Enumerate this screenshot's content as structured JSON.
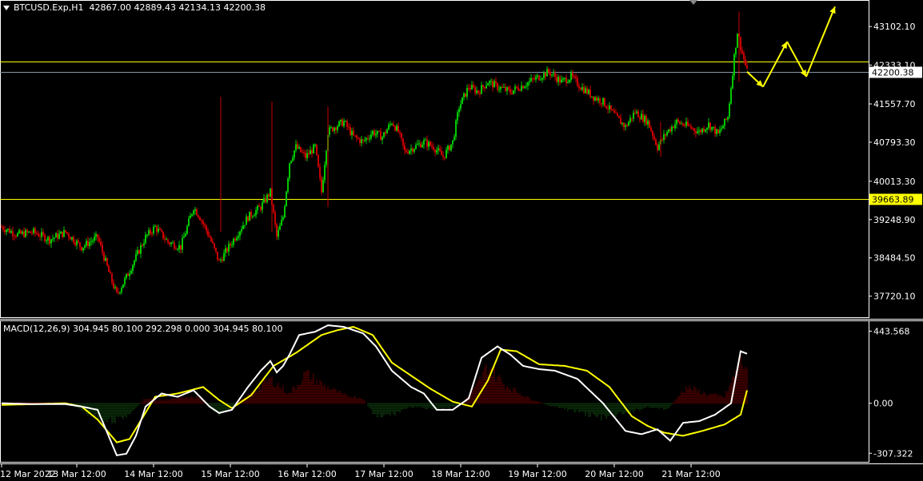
{
  "header": {
    "symbol_line": "BTCUSD.Exp,H1",
    "ohlc": "42867.00 42889.43 42134.13 42200.38"
  },
  "macd_header": "MACD(12,26,9) 304.945 80.100 292.298 0.000 304.945 80.100",
  "colors": {
    "background": "#000000",
    "bull": "#00c800",
    "bear": "#c80000",
    "level": "#ffff00",
    "bid_line": "#8899aa",
    "arrow": "#ffff00",
    "macd_line": "#ffffff",
    "signal_line": "#ffff00"
  },
  "chart_data": [
    {
      "type": "candlestick",
      "title": "BTCUSD.Exp,H1",
      "ylim": [
        37300,
        43600
      ],
      "y_ticks": [
        "43102.10",
        "42333.10",
        "41557.70",
        "40793.30",
        "40013.30",
        "39248.90",
        "38484.50",
        "37720.10"
      ],
      "x_ticks": [
        "12 Mar 2022",
        "13 Mar 12:00",
        "14 Mar 12:00",
        "15 Mar 12:00",
        "16 Mar 12:00",
        "17 Mar 12:00",
        "18 Mar 12:00",
        "19 Mar 12:00",
        "20 Mar 12:00",
        "21 Mar 12:00"
      ],
      "levels": [
        {
          "value": 42400,
          "label": ""
        },
        {
          "value": 39663.89,
          "label": "39663.89"
        }
      ],
      "bid": {
        "value": 42200.38,
        "label": "42200.38"
      },
      "close_path": [
        [
          0,
          39100
        ],
        [
          10,
          38950
        ],
        [
          20,
          39000
        ],
        [
          30,
          38850
        ],
        [
          40,
          39000
        ],
        [
          50,
          38700
        ],
        [
          60,
          38900
        ],
        [
          68,
          38100
        ],
        [
          72,
          37750
        ],
        [
          78,
          38100
        ],
        [
          84,
          38500
        ],
        [
          90,
          38900
        ],
        [
          96,
          39100
        ],
        [
          104,
          38800
        ],
        [
          112,
          38700
        ],
        [
          120,
          39500
        ],
        [
          124,
          39300
        ],
        [
          130,
          38900
        ],
        [
          136,
          38400
        ],
        [
          144,
          38800
        ],
        [
          154,
          39300
        ],
        [
          162,
          39500
        ],
        [
          168,
          39800
        ],
        [
          172,
          38900
        ],
        [
          176,
          39300
        ],
        [
          180,
          40400
        ],
        [
          184,
          40700
        ],
        [
          190,
          40500
        ],
        [
          196,
          40700
        ],
        [
          200,
          39800
        ],
        [
          204,
          41000
        ],
        [
          208,
          41100
        ],
        [
          214,
          41200
        ],
        [
          220,
          40900
        ],
        [
          226,
          40800
        ],
        [
          232,
          41000
        ],
        [
          238,
          40900
        ],
        [
          244,
          41200
        ],
        [
          248,
          41000
        ],
        [
          252,
          40600
        ],
        [
          258,
          40700
        ],
        [
          264,
          40800
        ],
        [
          270,
          40700
        ],
        [
          276,
          40500
        ],
        [
          282,
          40800
        ],
        [
          286,
          41500
        ],
        [
          292,
          41900
        ],
        [
          298,
          41800
        ],
        [
          304,
          42000
        ],
        [
          310,
          41900
        ],
        [
          318,
          41800
        ],
        [
          324,
          41900
        ],
        [
          330,
          42000
        ],
        [
          336,
          42100
        ],
        [
          342,
          42200
        ],
        [
          350,
          42000
        ],
        [
          356,
          42100
        ],
        [
          362,
          41900
        ],
        [
          370,
          41700
        ],
        [
          376,
          41600
        ],
        [
          384,
          41300
        ],
        [
          390,
          41100
        ],
        [
          396,
          41400
        ],
        [
          404,
          41200
        ],
        [
          410,
          40700
        ],
        [
          416,
          41000
        ],
        [
          422,
          41200
        ],
        [
          430,
          41100
        ],
        [
          436,
          41000
        ],
        [
          442,
          41150
        ],
        [
          448,
          40950
        ],
        [
          454,
          41300
        ],
        [
          458,
          42500
        ],
        [
          460,
          43000
        ],
        [
          462,
          42700
        ],
        [
          466,
          42200
        ]
      ],
      "forecast_path": [
        [
          466,
          42200
        ],
        [
          476,
          41900
        ],
        [
          491,
          42800
        ],
        [
          503,
          42100
        ],
        [
          521,
          43500
        ]
      ]
    },
    {
      "type": "macd",
      "title": "MACD(12,26,9)",
      "ylim": [
        -360,
        500
      ],
      "y_ticks": [
        "443.568",
        "0.00",
        "-307.322"
      ],
      "macd_path": [
        [
          0,
          0
        ],
        [
          20,
          -5
        ],
        [
          40,
          -5
        ],
        [
          50,
          -20
        ],
        [
          60,
          -40
        ],
        [
          66,
          -180
        ],
        [
          72,
          -320
        ],
        [
          78,
          -310
        ],
        [
          84,
          -200
        ],
        [
          90,
          -20
        ],
        [
          100,
          60
        ],
        [
          110,
          40
        ],
        [
          120,
          80
        ],
        [
          124,
          40
        ],
        [
          130,
          -20
        ],
        [
          136,
          -60
        ],
        [
          144,
          -40
        ],
        [
          154,
          100
        ],
        [
          162,
          200
        ],
        [
          168,
          260
        ],
        [
          172,
          190
        ],
        [
          176,
          230
        ],
        [
          180,
          300
        ],
        [
          186,
          420
        ],
        [
          196,
          440
        ],
        [
          204,
          480
        ],
        [
          214,
          470
        ],
        [
          226,
          430
        ],
        [
          234,
          350
        ],
        [
          244,
          200
        ],
        [
          256,
          100
        ],
        [
          264,
          60
        ],
        [
          272,
          -40
        ],
        [
          282,
          -40
        ],
        [
          292,
          30
        ],
        [
          300,
          280
        ],
        [
          310,
          350
        ],
        [
          318,
          300
        ],
        [
          326,
          230
        ],
        [
          336,
          210
        ],
        [
          346,
          200
        ],
        [
          360,
          150
        ],
        [
          376,
          0
        ],
        [
          390,
          -170
        ],
        [
          400,
          -190
        ],
        [
          410,
          -160
        ],
        [
          418,
          -230
        ],
        [
          426,
          -120
        ],
        [
          436,
          -110
        ],
        [
          446,
          -70
        ],
        [
          456,
          0
        ],
        [
          462,
          320
        ],
        [
          466,
          305
        ]
      ],
      "signal_path": [
        [
          0,
          -10
        ],
        [
          20,
          -5
        ],
        [
          40,
          0
        ],
        [
          50,
          -20
        ],
        [
          60,
          -100
        ],
        [
          72,
          -240
        ],
        [
          80,
          -220
        ],
        [
          96,
          40
        ],
        [
          110,
          60
        ],
        [
          126,
          100
        ],
        [
          136,
          20
        ],
        [
          144,
          -30
        ],
        [
          156,
          50
        ],
        [
          170,
          230
        ],
        [
          184,
          310
        ],
        [
          200,
          420
        ],
        [
          210,
          450
        ],
        [
          220,
          470
        ],
        [
          232,
          420
        ],
        [
          244,
          250
        ],
        [
          256,
          170
        ],
        [
          268,
          90
        ],
        [
          282,
          10
        ],
        [
          294,
          -20
        ],
        [
          304,
          140
        ],
        [
          312,
          330
        ],
        [
          322,
          320
        ],
        [
          336,
          240
        ],
        [
          352,
          230
        ],
        [
          366,
          200
        ],
        [
          380,
          100
        ],
        [
          394,
          -80
        ],
        [
          404,
          -140
        ],
        [
          414,
          -180
        ],
        [
          426,
          -200
        ],
        [
          438,
          -170
        ],
        [
          452,
          -130
        ],
        [
          462,
          -70
        ],
        [
          466,
          80
        ]
      ],
      "hist_path": [
        [
          0,
          5
        ],
        [
          40,
          10
        ],
        [
          50,
          -40
        ],
        [
          66,
          -120
        ],
        [
          78,
          -80
        ],
        [
          90,
          30
        ],
        [
          100,
          20
        ],
        [
          124,
          40
        ],
        [
          136,
          -80
        ],
        [
          150,
          20
        ],
        [
          168,
          150
        ],
        [
          180,
          60
        ],
        [
          190,
          180
        ],
        [
          200,
          120
        ],
        [
          214,
          50
        ],
        [
          226,
          30
        ],
        [
          234,
          -90
        ],
        [
          246,
          -60
        ],
        [
          256,
          -20
        ],
        [
          270,
          -40
        ],
        [
          286,
          -20
        ],
        [
          296,
          90
        ],
        [
          304,
          230
        ],
        [
          314,
          120
        ],
        [
          330,
          30
        ],
        [
          344,
          -20
        ],
        [
          360,
          -50
        ],
        [
          376,
          -90
        ],
        [
          392,
          -60
        ],
        [
          404,
          -20
        ],
        [
          416,
          -40
        ],
        [
          428,
          100
        ],
        [
          440,
          60
        ],
        [
          452,
          40
        ],
        [
          462,
          250
        ],
        [
          466,
          230
        ]
      ]
    }
  ]
}
